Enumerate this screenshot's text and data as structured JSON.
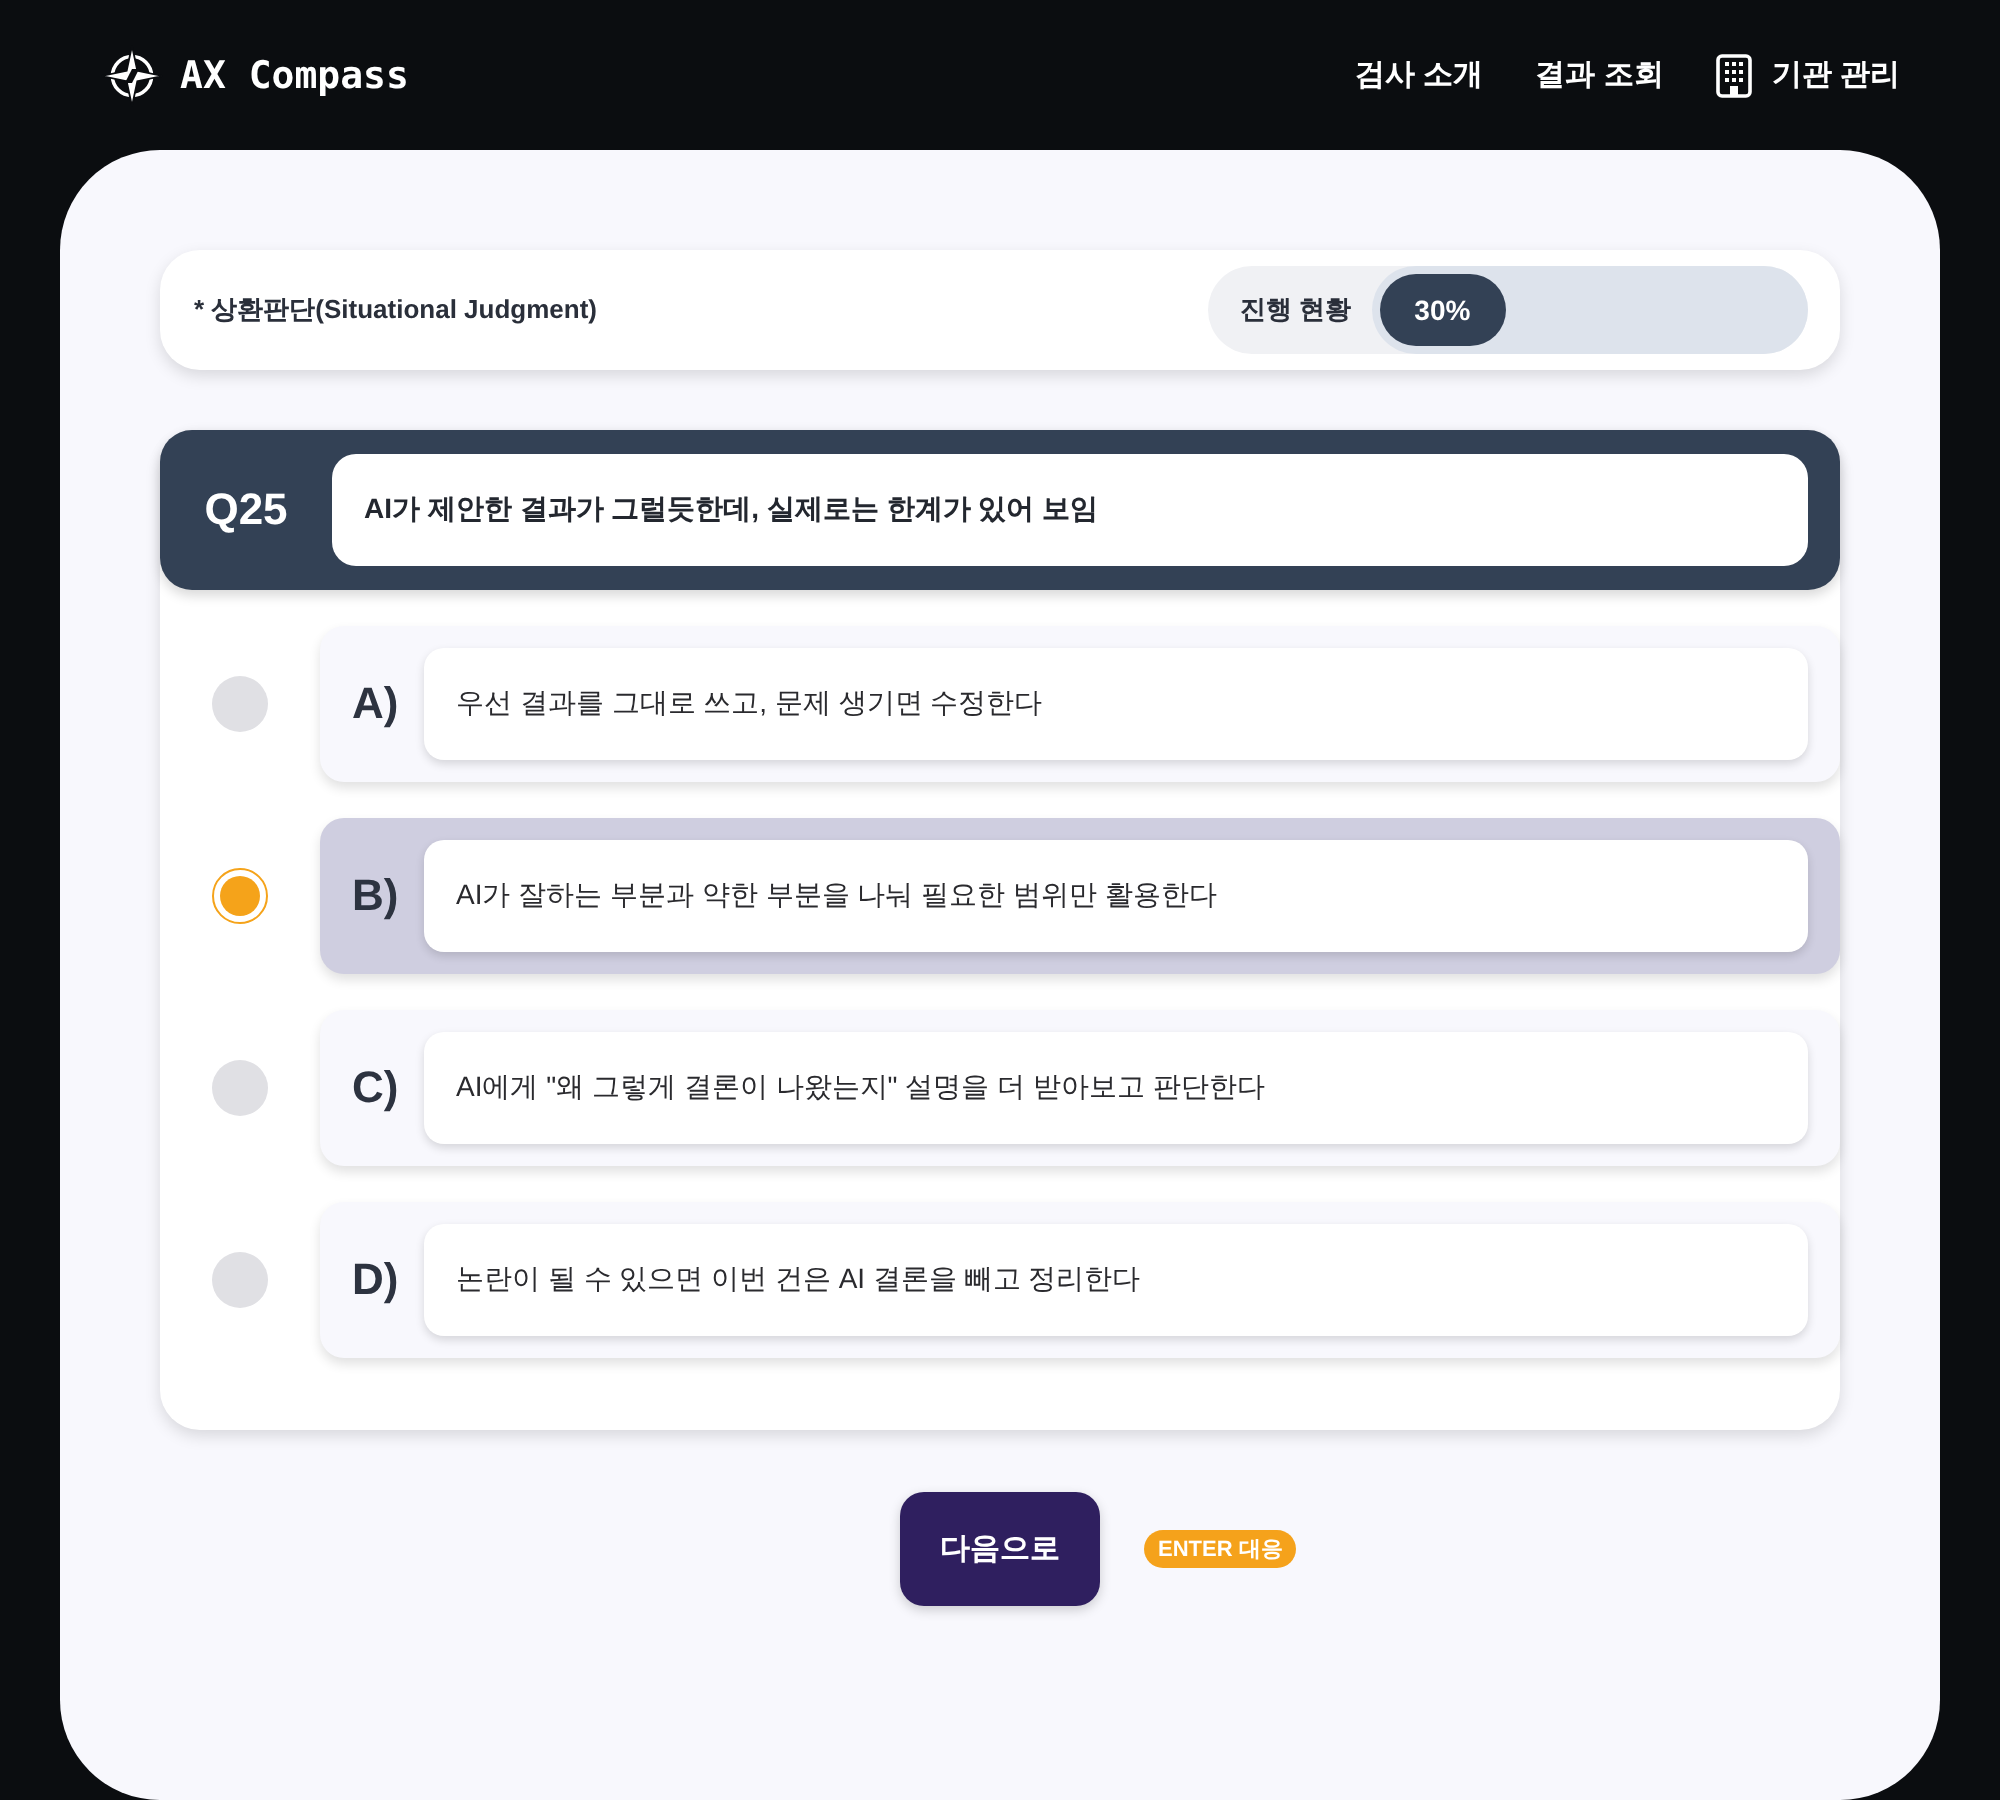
{
  "header": {
    "brand": "AX Compass",
    "nav": [
      {
        "label": "검사 소개",
        "has_icon": false
      },
      {
        "label": "결과 조회",
        "has_icon": false
      },
      {
        "label": "기관 관리",
        "has_icon": true
      }
    ]
  },
  "info_bar": {
    "section_label": "* 상환판단(Situational Judgment)",
    "progress": {
      "label": "진행 현황",
      "level": 0.3,
      "reading": "30%"
    }
  },
  "question": {
    "number": "Q25",
    "text": "AI가 제안한 결과가 그럴듯한데, 실제로는 한계가 있어 보임",
    "options": [
      {
        "letter": "A)",
        "text": "우선 결과를 그대로 쓰고, 문제 생기면 수정한다",
        "selected": false
      },
      {
        "letter": "B)",
        "text": "AI가 잘하는 부분과 약한 부분을 나눠 필요한 범위만 활용한다",
        "selected": true
      },
      {
        "letter": "C)",
        "text": "AI에게 \"왜 그렇게 결론이 나왔는지\" 설명을 더 받아보고 판단한다",
        "selected": false
      },
      {
        "letter": "D)",
        "text": "논란이 될 수 있으면 이번 건은 AI 결론을 빼고 정리한다",
        "selected": false
      }
    ]
  },
  "next_button": {
    "label": "다음으로"
  },
  "shortcut_hint": "ENTER 대응"
}
